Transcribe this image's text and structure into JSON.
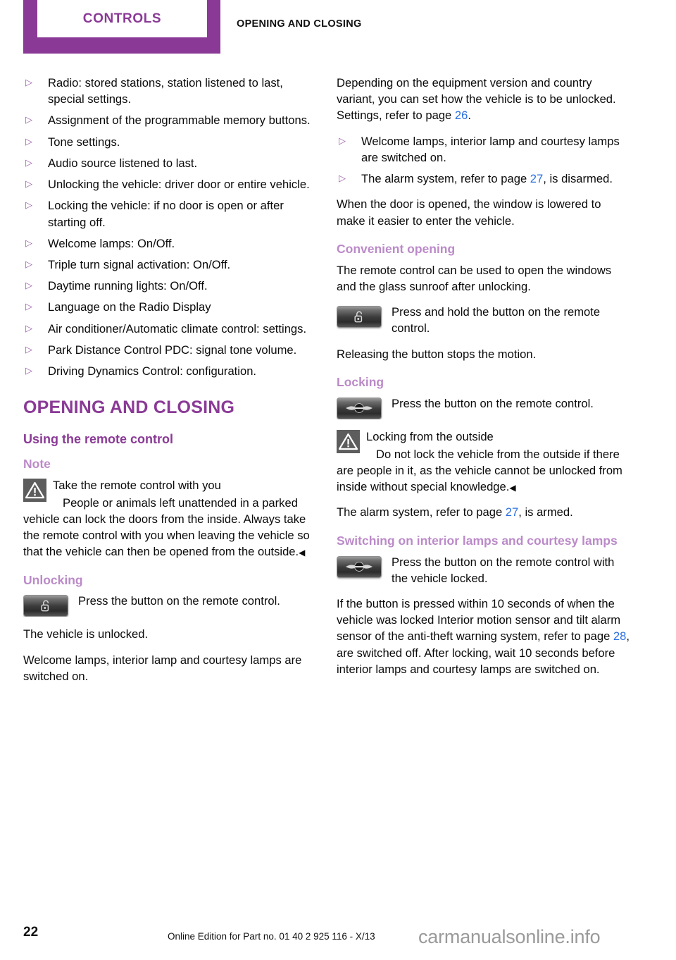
{
  "header": {
    "tab_label": "CONTROLS",
    "section_title": "OPENING AND CLOSING"
  },
  "colors": {
    "brand_purple": "#8a3a96",
    "light_purple": "#bb8ac8",
    "bullet_purple": "#9b5fa8",
    "page_link_blue": "#2b6fe0",
    "icon_gray": "#5d5d5d"
  },
  "left_column": {
    "settings_bullets": [
      "Radio: stored stations, station listened to last, special settings.",
      "Assignment of the programmable memory buttons.",
      "Tone settings.",
      "Audio source listened to last.",
      "Unlocking the vehicle: driver door or entire vehicle.",
      "Locking the vehicle: if no door is open or after starting off.",
      "Welcome lamps: On/Off.",
      "Triple turn signal activation: On/Off.",
      "Daytime running lights: On/Off.",
      "Language on the Radio Display",
      "Air conditioner/Automatic climate control: settings.",
      "Park Distance Control PDC: signal tone volume.",
      "Driving Dynamics Control: configuration."
    ],
    "chapter_heading": "OPENING AND CLOSING",
    "section_heading": "Using the remote control",
    "note_heading": "Note",
    "note_title": "Take the remote control with you",
    "note_body": "People or animals left unattended in a parked vehicle can lock the doors from the inside. Always take the remote control with you when leaving the vehicle so that the vehicle can then be opened from the outside.",
    "note_endmark": "◀",
    "unlocking_heading": "Unlocking",
    "unlocking_key_text": "Press the button on the remote control.",
    "unlocking_result": "The vehicle is unlocked.",
    "unlocking_lamps": "Welcome lamps, interior lamp and courtesy lamps are switched on."
  },
  "right_column": {
    "intro_part1": "Depending on the equipment version and country variant, you can set how the vehicle is to be unlocked. Settings, refer to page ",
    "intro_pageref": "26",
    "intro_part2": ".",
    "bullets": [
      {
        "text_before": "Welcome lamps, interior lamp and courtesy lamps are switched on.",
        "pageref": "",
        "text_after": ""
      },
      {
        "text_before": "The alarm system, refer to page ",
        "pageref": "27",
        "text_after": ", is disarmed."
      }
    ],
    "window_para": "When the door is opened, the window is lowered to make it easier to enter the vehicle.",
    "convenient_heading": "Convenient opening",
    "convenient_para": "The remote control can be used to open the windows and the glass sunroof after unlocking.",
    "convenient_key_text": "Press and hold the button on the remote control.",
    "releasing_para": "Releasing the button stops the motion.",
    "locking_heading": "Locking",
    "locking_key_text": "Press the button on the remote control.",
    "warn_title": "Locking from the outside",
    "warn_body": "Do not lock the vehicle from the outside if there are people in it, as the vehicle cannot be unlocked from inside without special knowledge.",
    "warn_endmark": "◀",
    "alarm_part1": "The alarm system, refer to page ",
    "alarm_pageref": "27",
    "alarm_part2": ", is armed.",
    "interior_heading": "Switching on interior lamps and courtesy lamps",
    "interior_key_text": "Press the button on the remote control with the vehicle locked.",
    "interior_body_part1": "If the button is pressed within 10 seconds of when the vehicle was locked Interior motion sensor and tilt alarm sensor of the anti-theft warning system, refer to page ",
    "interior_body_pageref": "28",
    "interior_body_part2": ", are switched off. After locking, wait 10 seconds before interior lamps and courtesy lamps are switched on."
  },
  "footer": {
    "page_number": "22",
    "edition_note": "Online Edition for Part no. 01 40 2 925 116 - X/13",
    "watermark": "carmanualsonline.info"
  },
  "icons": {
    "warning": "warning-triangle-icon",
    "unlock_key": "remote-unlock-button-icon",
    "lock_key": "remote-lock-mini-logo-button-icon"
  }
}
